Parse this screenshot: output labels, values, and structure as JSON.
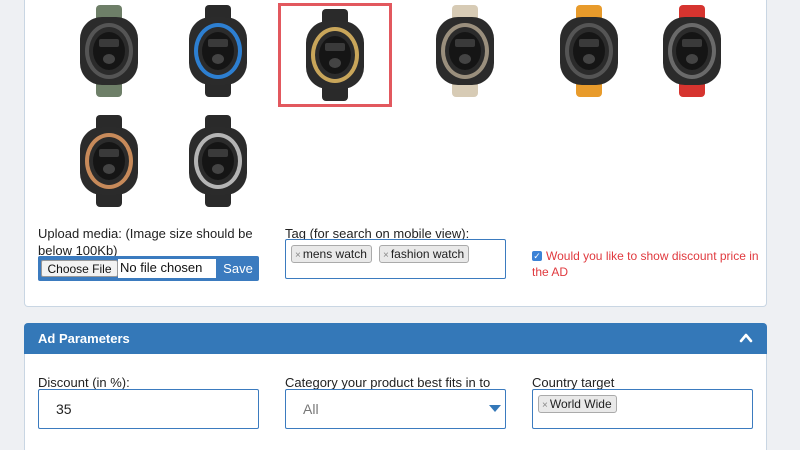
{
  "media": {
    "thumbs": [
      {
        "name": "watch-green",
        "strap": "#6e7f68",
        "bezel": "#555",
        "selected": false
      },
      {
        "name": "watch-blue",
        "strap": "#2a2a2a",
        "bezel": "#2d7fd1",
        "selected": false
      },
      {
        "name": "watch-gold",
        "strap": "#2a2a2a",
        "bezel": "#c9a65a",
        "selected": true
      },
      {
        "name": "watch-beige",
        "strap": "#d7cbb5",
        "bezel": "#9a8f7d",
        "selected": false
      },
      {
        "name": "watch-orange",
        "strap": "#e89b2b",
        "bezel": "#555",
        "selected": false
      },
      {
        "name": "watch-red",
        "strap": "#d6342f",
        "bezel": "#6a6a6a",
        "selected": false
      },
      {
        "name": "watch-rose",
        "strap": "#2a2a2a",
        "bezel": "#c78a5a",
        "selected": false
      },
      {
        "name": "watch-silver",
        "strap": "#2a2a2a",
        "bezel": "#b5b5b5",
        "selected": false
      }
    ],
    "upload_label": "Upload media: (Image size should be below 100Kb)",
    "choose_file_label": "Choose File",
    "no_file_text": "No file chosen",
    "save_label": "Save"
  },
  "tags": {
    "label": "Tag (for search on mobile view):",
    "items": [
      "mens watch",
      "fashion watch"
    ]
  },
  "discount_option": {
    "checked": true,
    "label": "Would you like to show discount price in the AD"
  },
  "ad_parameters": {
    "title": "Ad Parameters",
    "discount_label": "Discount (in %):",
    "discount_value": "35",
    "category_label": "Category your product best fits in to",
    "category_value": "All",
    "country_label": "Country target",
    "country_tags": [
      "World Wide"
    ]
  },
  "colors": {
    "accent": "#3478b8",
    "selected_border": "#e2585e",
    "warning_text": "#e0393e"
  }
}
